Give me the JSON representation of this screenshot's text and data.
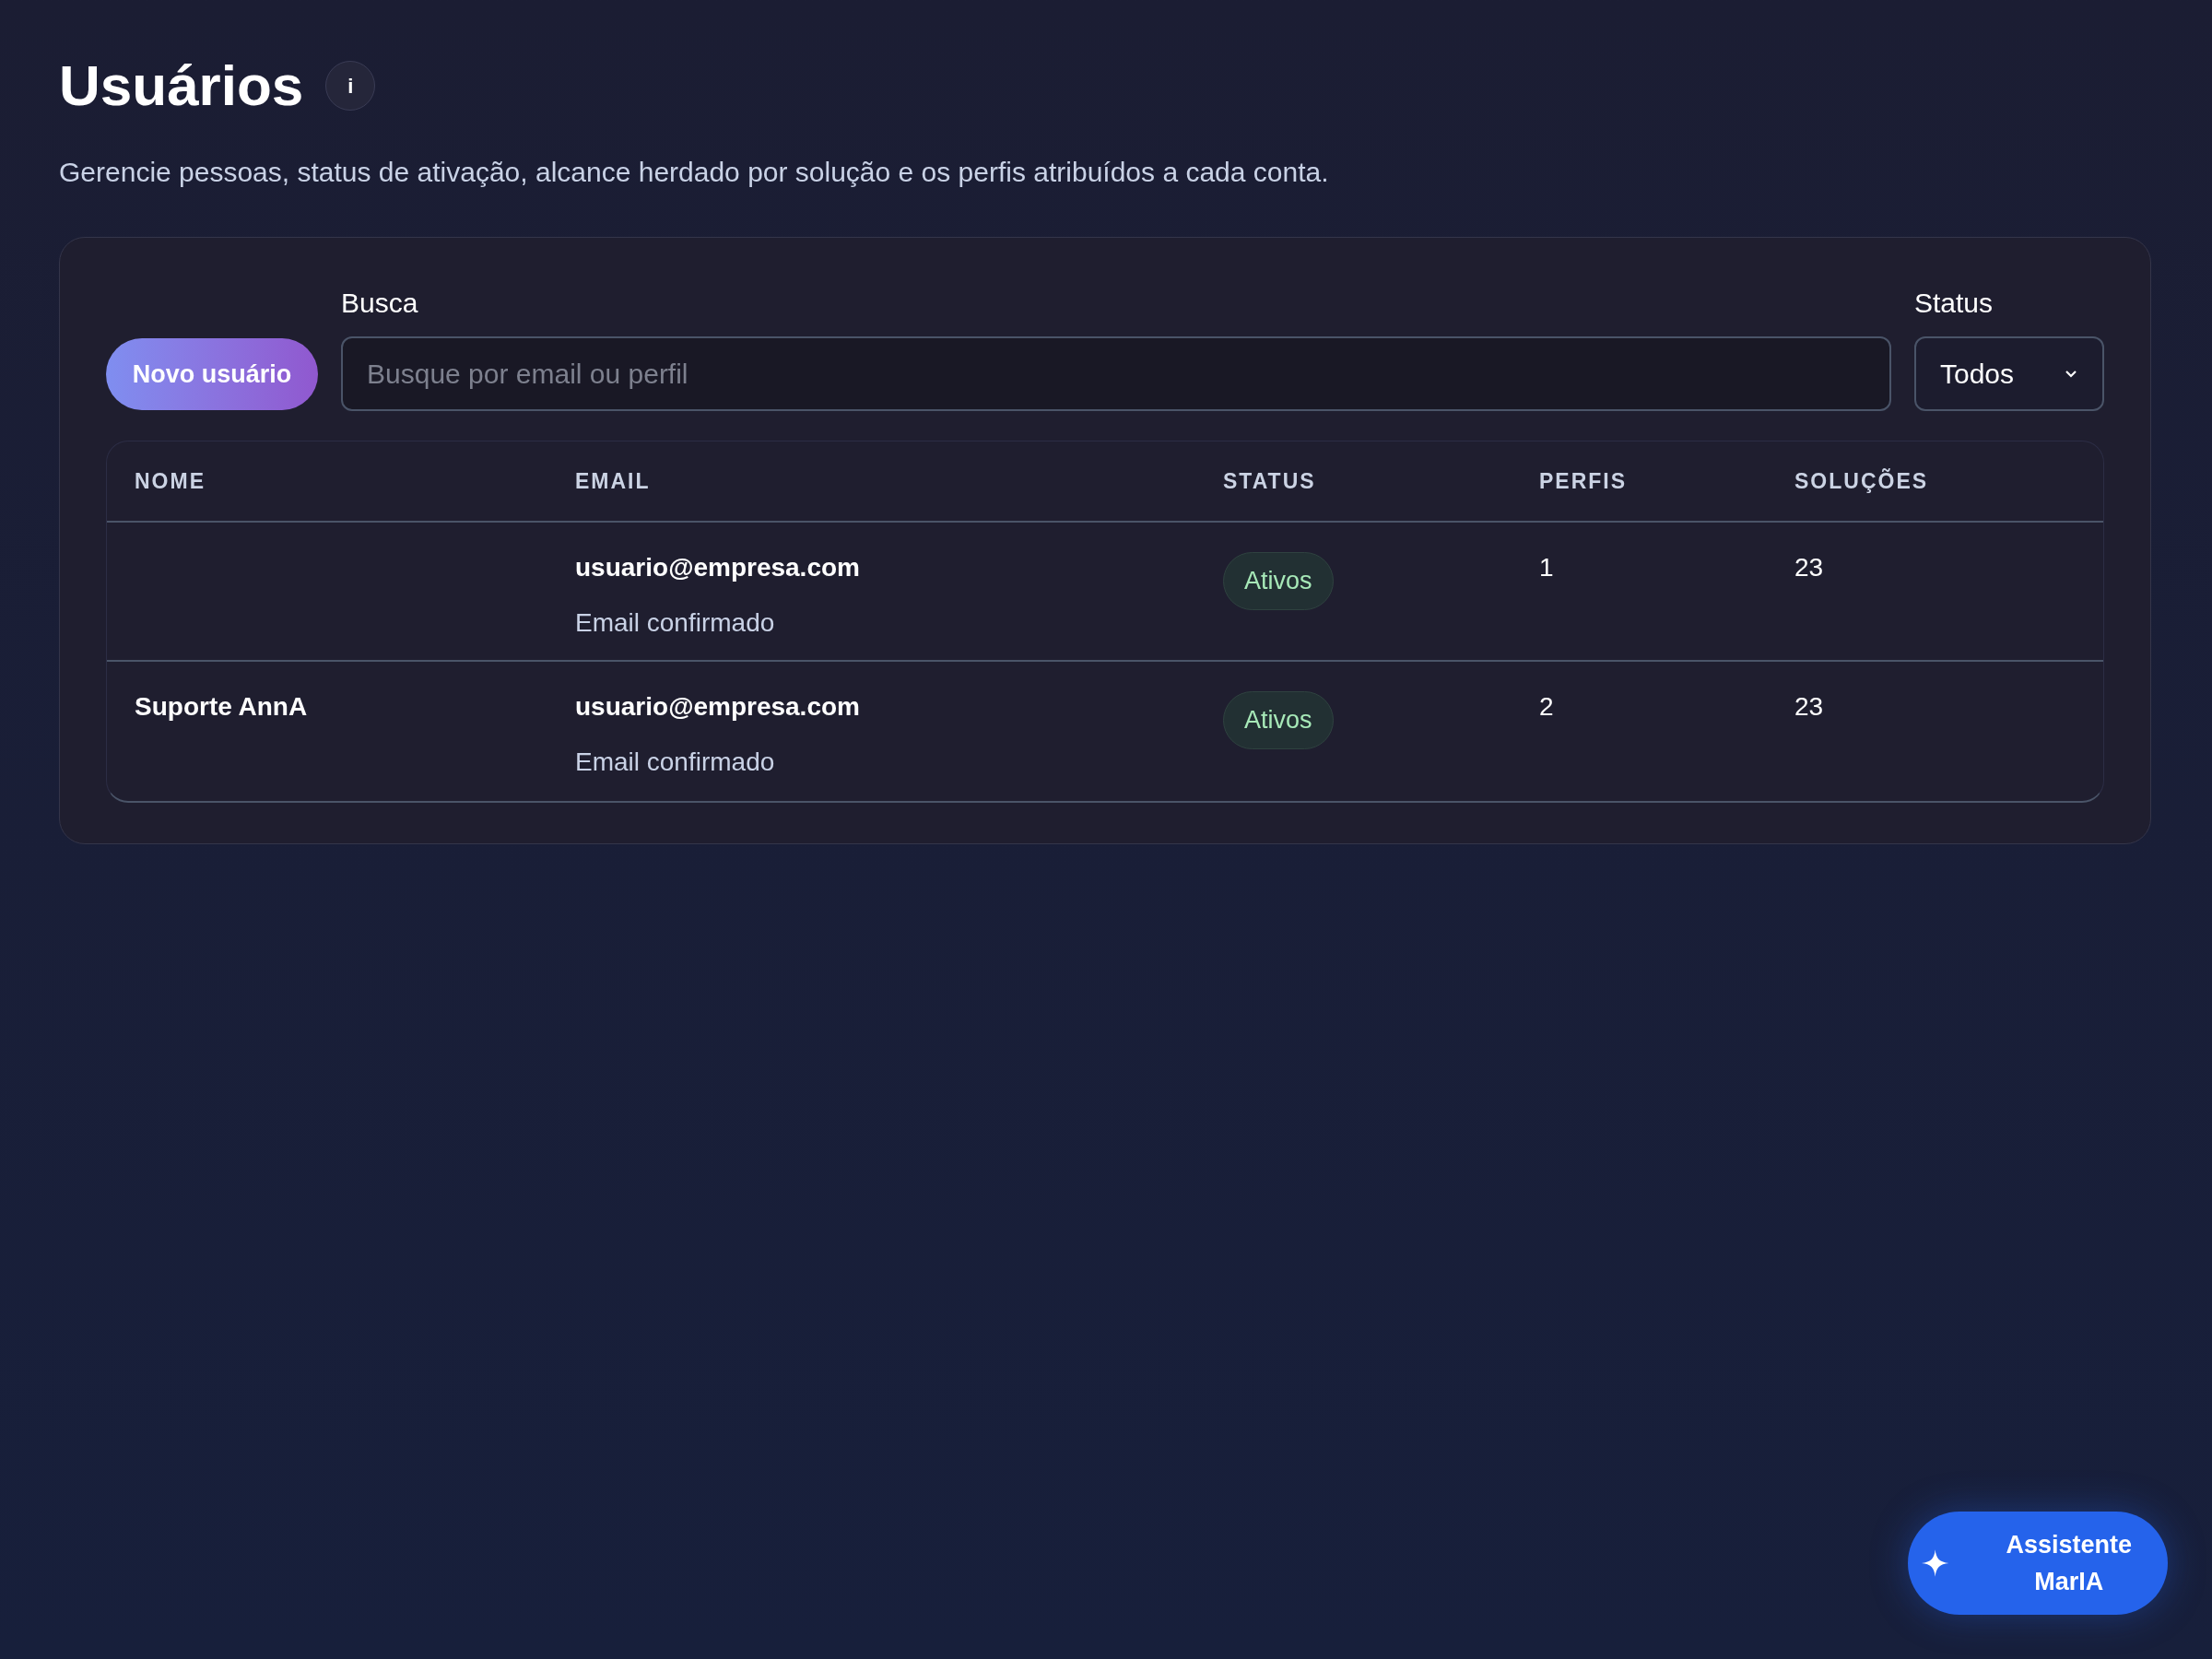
{
  "header": {
    "title": "Usuários",
    "info_button": "i",
    "subtitle": "Gerencie pessoas, status de ativação, alcance herdado por solução e os perfis atribuídos a cada conta."
  },
  "toolbar": {
    "new_button": "Novo usuário",
    "search": {
      "label": "Busca",
      "placeholder": "Busque por email ou perfil"
    },
    "status_filter": {
      "label": "Status",
      "value": "Todos"
    }
  },
  "table": {
    "columns": [
      "NOME",
      "EMAIL",
      "STATUS",
      "PERFIS",
      "SOLUÇÕES"
    ],
    "rows": [
      {
        "email": "usuario@empresa.com",
        "email_note": "Email confirmado",
        "status": "Ativos",
        "profiles": "1",
        "solutions": "23"
      },
      {
        "name": "Suporte AnnA",
        "email": "usuario@empresa.com",
        "email_note": "Email confirmado",
        "status": "Ativos",
        "profiles": "2",
        "solutions": "23"
      }
    ]
  },
  "assistant_button": "Assistente MarIA"
}
